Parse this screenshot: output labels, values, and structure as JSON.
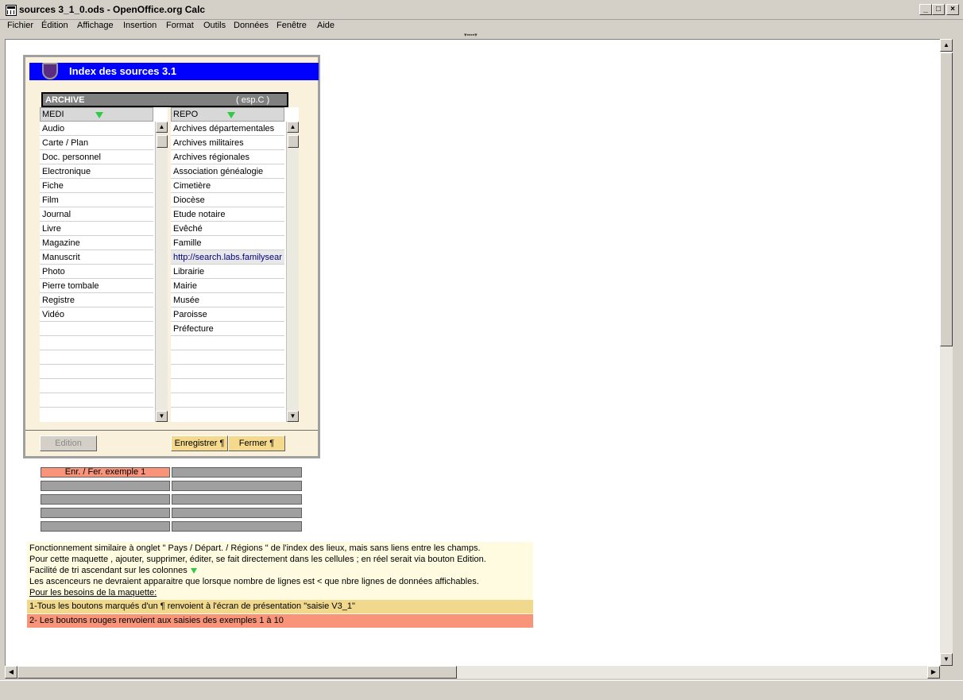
{
  "window": {
    "title": "sources 3_1_0.ods - OpenOffice.org Calc"
  },
  "menu": [
    "Fichier",
    "Édition",
    "Affichage",
    "Insertion",
    "Format",
    "Outils",
    "Données",
    "Fenêtre",
    "Aide"
  ],
  "panel": {
    "title": "Index des sources 3.1",
    "archive_label": "ARCHIVE",
    "archive_hint": "( esp.C )",
    "medi": {
      "header": "MEDI",
      "rows": [
        "Audio",
        "Carte / Plan",
        "Doc. personnel",
        "Electronique",
        "Fiche",
        "Film",
        "Journal",
        "Livre",
        "Magazine",
        "Manuscrit",
        "Photo",
        "Pierre tombale",
        "Registre",
        "Vidéo"
      ]
    },
    "repo": {
      "header": "REPO",
      "rows": [
        "Archives départementales",
        "Archives militaires",
        "Archives régionales",
        "Association généalogie",
        "Cimetière",
        "Diocèse",
        "Etude notaire",
        "Evêché",
        "Famille",
        "http://search.labs.familysear",
        "Librairie",
        "Mairie",
        "Musée",
        "Paroisse",
        "Préfecture"
      ]
    },
    "buttons": {
      "edition": "Edition",
      "save": "Enregistrer ¶",
      "close": "Fermer ¶"
    }
  },
  "examples": {
    "first": "Enr. / Fer. exemple 1"
  },
  "notes": {
    "line1": "Fonctionnement similaire à onglet \" Pays / Départ. / Régions \" de l'index des lieux, mais sans liens entre les champs.",
    "line2": "Pour cette maquette , ajouter, supprimer, éditer, se fait directement dans les cellules ; en réel serait via bouton Edition.",
    "line3": "Facilité de tri ascendant sur les colonnes",
    "line4": "Les ascenceurs ne devraient apparaitre que lorsque nombre de lignes  est  < que nbre  lignes de données affichables.",
    "line5": "Pour les besoins de la maquette:",
    "band1": "1-Tous les boutons marqués d'un ¶ renvoient à l'écran de présentation \"saisie V3_1\"",
    "band2": "2- Les boutons rouges renvoient aux saisies des exemples 1 à 10"
  },
  "colors": {
    "title_blue": "#0000ff",
    "sort_green": "#2ecc40",
    "button_yellow": "#f5d98c",
    "example_red": "#f8947a",
    "band_yellow": "#f0d98c"
  }
}
